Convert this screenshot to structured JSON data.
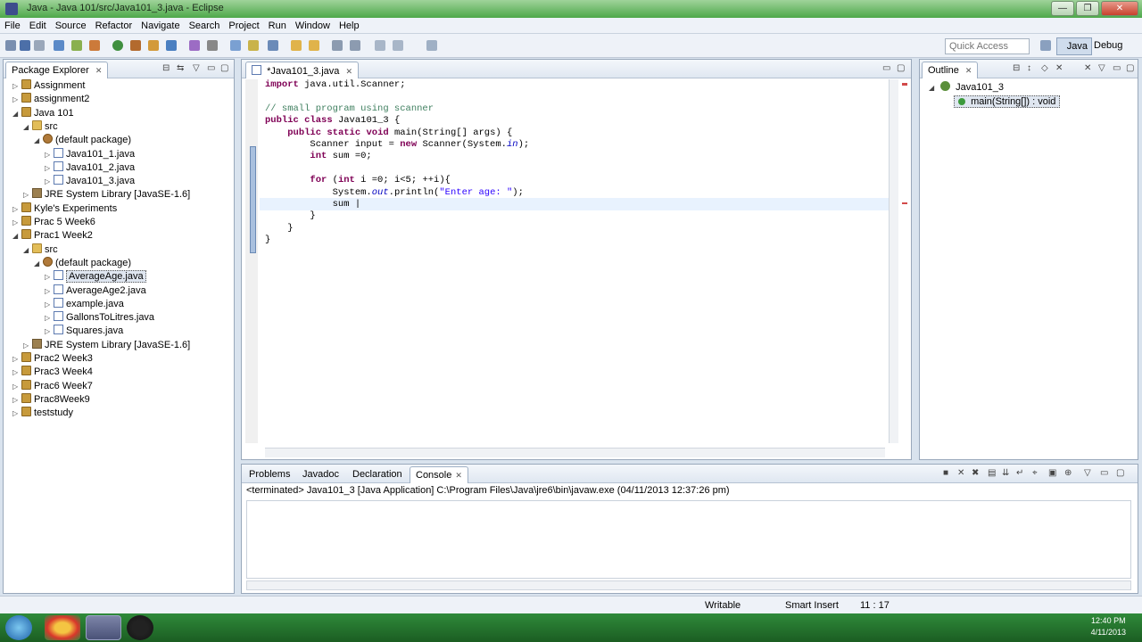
{
  "window": {
    "title": "Java - Java 101/src/Java101_3.java - Eclipse",
    "min_label": "—",
    "max_label": "❐",
    "close_label": "✕"
  },
  "menu": [
    "File",
    "Edit",
    "Source",
    "Refactor",
    "Navigate",
    "Search",
    "Project",
    "Run",
    "Window",
    "Help"
  ],
  "toolbar": {
    "quick_access_placeholder": "Quick Access",
    "perspective_java": "Java",
    "perspective_debug": "Debug"
  },
  "package_explorer": {
    "tab_label": "Package Explorer",
    "items": [
      {
        "label": "Assignment",
        "kind": "project",
        "twisty": "▷"
      },
      {
        "label": "assignment2",
        "kind": "project",
        "twisty": "▷"
      },
      {
        "label": "Java 101",
        "kind": "project",
        "twisty": "◢"
      },
      {
        "label": "src",
        "kind": "folder",
        "twisty": "◢"
      },
      {
        "label": "(default package)",
        "kind": "package",
        "twisty": "◢"
      },
      {
        "label": "Java101_1.java",
        "kind": "java",
        "twisty": "▷"
      },
      {
        "label": "Java101_2.java",
        "kind": "java",
        "twisty": "▷"
      },
      {
        "label": "Java101_3.java",
        "kind": "java",
        "twisty": "▷"
      },
      {
        "label": "JRE System Library [JavaSE-1.6]",
        "kind": "jar",
        "twisty": "▷"
      },
      {
        "label": "Kyle's Experiments",
        "kind": "project",
        "twisty": "▷"
      },
      {
        "label": "Prac 5 Week6",
        "kind": "project",
        "twisty": "▷"
      },
      {
        "label": "Prac1 Week2",
        "kind": "project",
        "twisty": "◢"
      },
      {
        "label": "src",
        "kind": "folder",
        "twisty": "◢"
      },
      {
        "label": "(default package)",
        "kind": "package",
        "twisty": "◢"
      },
      {
        "label": "AverageAge.java",
        "kind": "java",
        "twisty": "▷",
        "selected": true
      },
      {
        "label": "AverageAge2.java",
        "kind": "java",
        "twisty": "▷"
      },
      {
        "label": "example.java",
        "kind": "java",
        "twisty": "▷"
      },
      {
        "label": "GallonsToLitres.java",
        "kind": "java",
        "twisty": "▷"
      },
      {
        "label": "Squares.java",
        "kind": "java",
        "twisty": "▷"
      },
      {
        "label": "JRE System Library [JavaSE-1.6]",
        "kind": "jar",
        "twisty": "▷"
      },
      {
        "label": "Prac2 Week3",
        "kind": "project",
        "twisty": "▷"
      },
      {
        "label": "Prac3 Week4",
        "kind": "project",
        "twisty": "▷"
      },
      {
        "label": "Prac6 Week7",
        "kind": "project",
        "twisty": "▷"
      },
      {
        "label": "Prac8Week9",
        "kind": "project",
        "twisty": "▷"
      },
      {
        "label": "teststudy",
        "kind": "project",
        "twisty": "▷"
      }
    ]
  },
  "editor": {
    "tab_label": "*Java101_3.java",
    "lines": [
      "import java.util.Scanner;",
      "",
      "// small program using scanner",
      "public class Java101_3 {",
      "    public static void main(String[] args) {",
      "        Scanner input = new Scanner(System.in);",
      "        int sum =0;",
      "",
      "        for (int i =0; i<5; ++i){",
      "            System.out.println(\"Enter age: \");",
      "            sum |",
      "        }",
      "    }",
      "}"
    ]
  },
  "outline": {
    "tab_label": "Outline",
    "class_name": "Java101_3",
    "method": "main(String[]) : void"
  },
  "console_pane": {
    "tabs": [
      "Problems",
      "Javadoc",
      "Declaration",
      "Console"
    ],
    "status": "<terminated> Java101_3 [Java Application] C:\\Program Files\\Java\\jre6\\bin\\javaw.exe (04/11/2013 12:37:26 pm)"
  },
  "statusbar": {
    "writable": "Writable",
    "insert_mode": "Smart Insert",
    "position": "11 : 17"
  },
  "taskbar": {
    "time": "12:40 PM",
    "date": "4/11/2013"
  },
  "colors": {
    "keyword": "#7f0055",
    "comment": "#3f7f5f",
    "string": "#2a00ff",
    "taskbar": "#2f8a3a"
  }
}
